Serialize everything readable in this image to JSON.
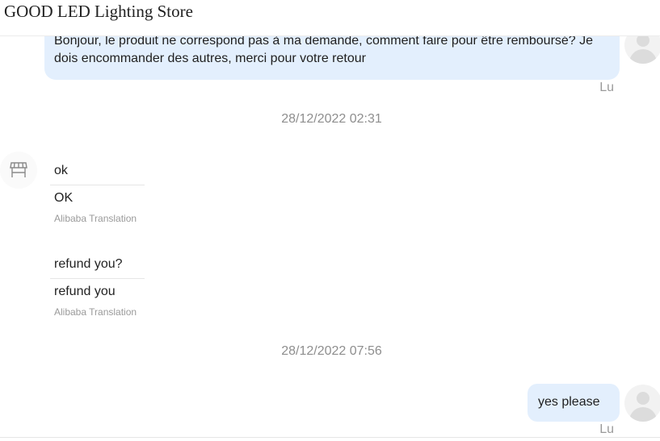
{
  "header": {
    "store_name": "GOOD LED Lighting Store"
  },
  "messages": [
    {
      "direction": "outgoing",
      "text": "Bonjour, le produit ne correspond pas à ma demande, comment faire pour être remboursé? Je dois encommander des autres, merci pour votre retour",
      "sender": "Lu"
    },
    {
      "type": "timestamp",
      "text": "28/12/2022 02:31"
    },
    {
      "direction": "incoming",
      "original": "ok",
      "translation": "OK",
      "translation_credit": "Alibaba Translation"
    },
    {
      "direction": "incoming",
      "original": "refund you?",
      "translation": "refund you",
      "translation_credit": "Alibaba Translation"
    },
    {
      "type": "timestamp",
      "text": "28/12/2022 07:56"
    },
    {
      "direction": "outgoing",
      "text": "yes please",
      "sender": "Lu"
    }
  ],
  "icons": {
    "store": "store-icon",
    "avatar": "user-avatar-icon"
  },
  "colors": {
    "outgoing_bubble": "#e3effd",
    "secondary_text": "#9a9a9a",
    "primary_text": "#222222"
  }
}
